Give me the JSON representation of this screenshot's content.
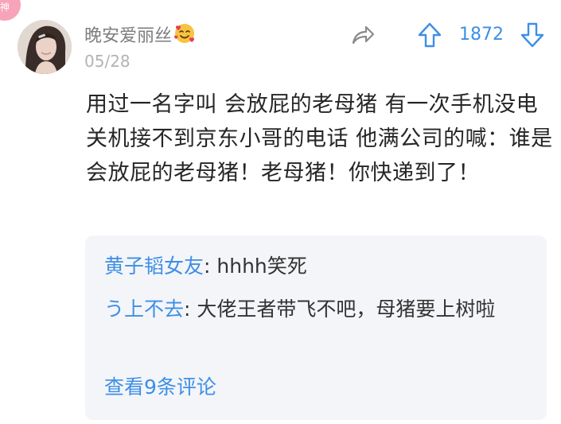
{
  "badge": {
    "label": "神"
  },
  "post": {
    "username": "晚安爱丽丝",
    "username_emoji_icon": "smiling-face-with-hearts-icon",
    "date": "05/28",
    "body": "用过一名字叫  会放屁的老母猪 有一次手机没电关机接不到京东小哥的电话 他满公司的喊：谁是会放屁的老母猪！老母猪！你快递到了！"
  },
  "actions": {
    "share_icon": "share-icon",
    "upvote_icon": "upvote-arrow-icon",
    "vote_count": "1872",
    "downvote_icon": "downvote-arrow-icon"
  },
  "replies": [
    {
      "author": "黄子韬女友",
      "separator": ":",
      "text": " hhhh笑死"
    },
    {
      "author": "う上不去",
      "separator": ":",
      "text": " 大佬王者带飞不吧，母猪要上树啦"
    }
  ],
  "view_all_label": "查看9条评论",
  "colors": {
    "accent": "#3d8fe6",
    "badge": "#f7a3b8",
    "reply_bg": "#f4f5f9",
    "text": "#262626",
    "muted": "#7d7d7d"
  }
}
